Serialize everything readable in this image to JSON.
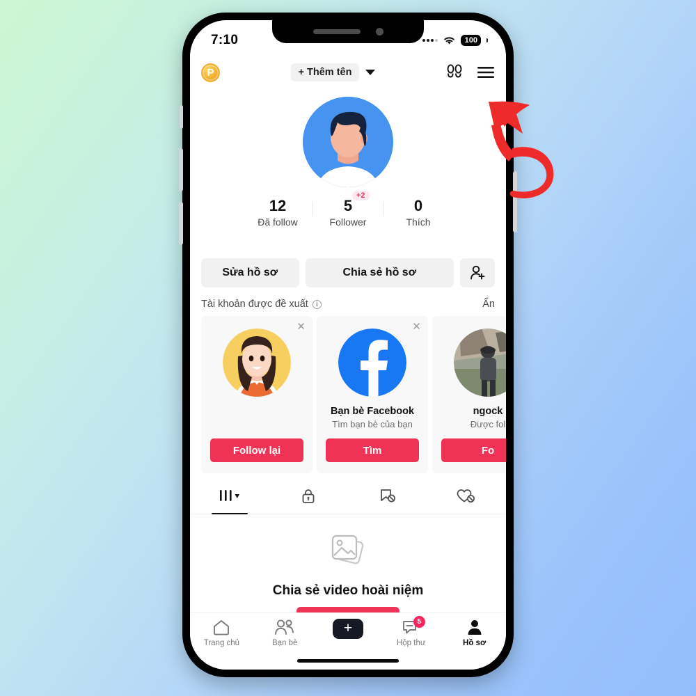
{
  "background": {
    "start_color": "#cdf6d3",
    "end_color": "#93bdfc"
  },
  "annotation": {
    "type": "red-curved-arrow",
    "color": "#ee2b2b",
    "points_to": "hamburger-menu-button"
  },
  "status_bar": {
    "time": "7:10",
    "battery": "100",
    "signal_icon": "signal-dots-icon",
    "wifi_icon": "wifi-icon",
    "battery_icon": "battery-icon"
  },
  "app_header": {
    "coin_label": "P",
    "add_name_label": "+ Thêm tên",
    "chevron_icon": "chevron-down-icon",
    "footprints_icon": "footprints-icon",
    "menu_icon": "hamburger-menu-icon"
  },
  "profile": {
    "avatar_icon": "user-avatar",
    "stats": [
      {
        "num": "12",
        "label": "Đã follow",
        "badge": null
      },
      {
        "num": "5",
        "label": "Follower",
        "badge": "+2"
      },
      {
        "num": "0",
        "label": "Thích",
        "badge": null
      }
    ],
    "actions": {
      "edit_label": "Sửa hồ sơ",
      "share_label": "Chia sẻ hồ sơ",
      "add_user_icon": "add-person-icon"
    }
  },
  "suggested": {
    "title": "Tài khoản được đề xuất",
    "info_icon": "info-icon",
    "hide_label": "Ẩn",
    "cards": [
      {
        "name": "",
        "sub": "",
        "button": "Follow lại",
        "avatar": "girl-cartoon-avatar",
        "close_icon": "close-icon"
      },
      {
        "name": "Bạn bè Facebook",
        "sub": "Tìm bạn bè của bạn",
        "button": "Tìm",
        "avatar": "facebook-logo",
        "close_icon": "close-icon"
      },
      {
        "name": "ngock",
        "sub": "Được fol",
        "button": "Fo",
        "avatar": "photo-avatar",
        "close_icon": "close-icon"
      }
    ]
  },
  "tabs": [
    {
      "icon": "grid-posts-icon",
      "active": true
    },
    {
      "icon": "lock-private-icon",
      "active": false
    },
    {
      "icon": "bookmark-off-icon",
      "active": false
    },
    {
      "icon": "heart-off-icon",
      "active": false
    }
  ],
  "empty_state": {
    "icon": "photos-stack-icon",
    "text": "Chia sẻ video hoài niệm"
  },
  "bottom_nav": {
    "items": [
      {
        "label": "Trang chủ",
        "icon": "home-icon",
        "active": false
      },
      {
        "label": "Bạn bè",
        "icon": "friends-icon",
        "active": false
      },
      {
        "label": "",
        "icon": "create-plus-icon",
        "active": false
      },
      {
        "label": "Hộp thư",
        "icon": "inbox-icon",
        "active": false,
        "badge": "5"
      },
      {
        "label": "Hồ sơ",
        "icon": "profile-person-icon",
        "active": true
      }
    ]
  },
  "colors": {
    "accent_pink": "#ef3356",
    "accent_cyan": "#22d8e8",
    "facebook_blue": "#1877f2"
  }
}
